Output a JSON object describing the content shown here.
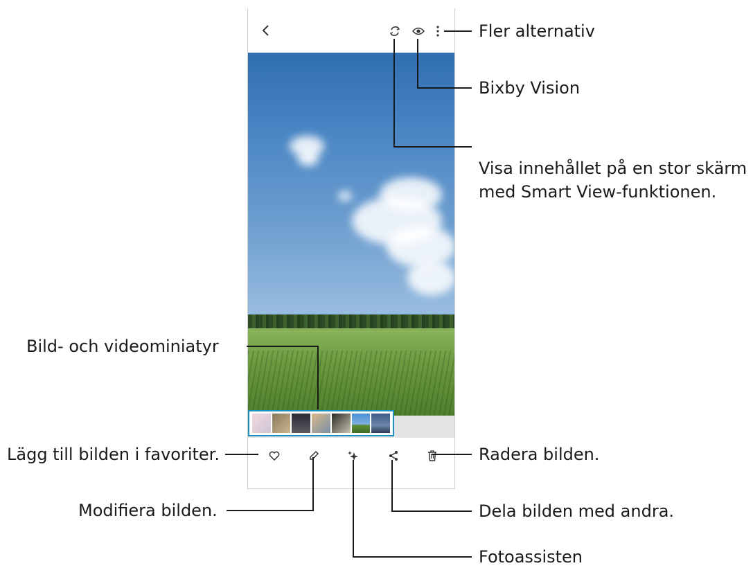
{
  "annotations": {
    "more_options": "Fler alternativ",
    "bixby_vision": "Bixby Vision",
    "smart_view_line1": "Visa innehållet på en stor skärm",
    "smart_view_line2": "med Smart View-funktionen.",
    "thumbnails": "Bild- och videominiatyr",
    "favorite": "Lägg till bilden i favoriter.",
    "delete": "Radera bilden.",
    "edit": "Modifiera bilden.",
    "share": "Dela bilden med andra.",
    "photo_assist": "Fotoassisten"
  },
  "phone": {
    "top_icons": [
      "back-icon",
      "smart-view-icon",
      "bixby-vision-icon",
      "more-options-icon"
    ],
    "bottom_icons": [
      "heart-icon",
      "pencil-icon",
      "sparkle-icon",
      "share-icon",
      "trash-icon"
    ],
    "thumbnail_count": 7
  },
  "colors": {
    "thumbnail_border": "#1a8fc0",
    "callout_line": "#1a1a1a"
  }
}
